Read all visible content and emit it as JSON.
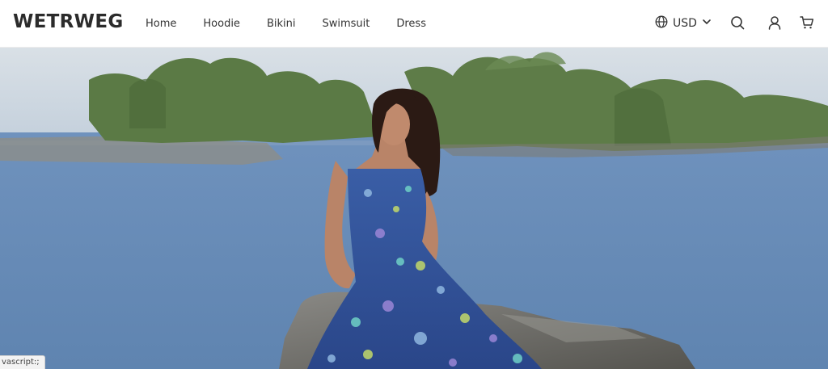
{
  "brand": {
    "logo_text": "WETRWEG"
  },
  "nav": {
    "items": [
      {
        "label": "Home"
      },
      {
        "label": "Hoodie"
      },
      {
        "label": "Bikini"
      },
      {
        "label": "Swimsuit"
      },
      {
        "label": "Dress"
      }
    ]
  },
  "header_actions": {
    "currency": {
      "value": "USD",
      "icon": "globe-icon",
      "chevron": "chevron-down-icon"
    },
    "search_icon": "search-icon",
    "account_icon": "user-icon",
    "cart_icon": "cart-icon"
  },
  "hero": {
    "image_alt": "Woman in blue floral maxi dress sitting on a rock by a lake",
    "colors": {
      "sky": "#cfd8e0",
      "water": "#6c8db5",
      "trees": "#56763f",
      "dress": "#2f4f9a",
      "rock": "#6b6b68"
    }
  },
  "status_bar": {
    "url_text": "vascript:;"
  }
}
